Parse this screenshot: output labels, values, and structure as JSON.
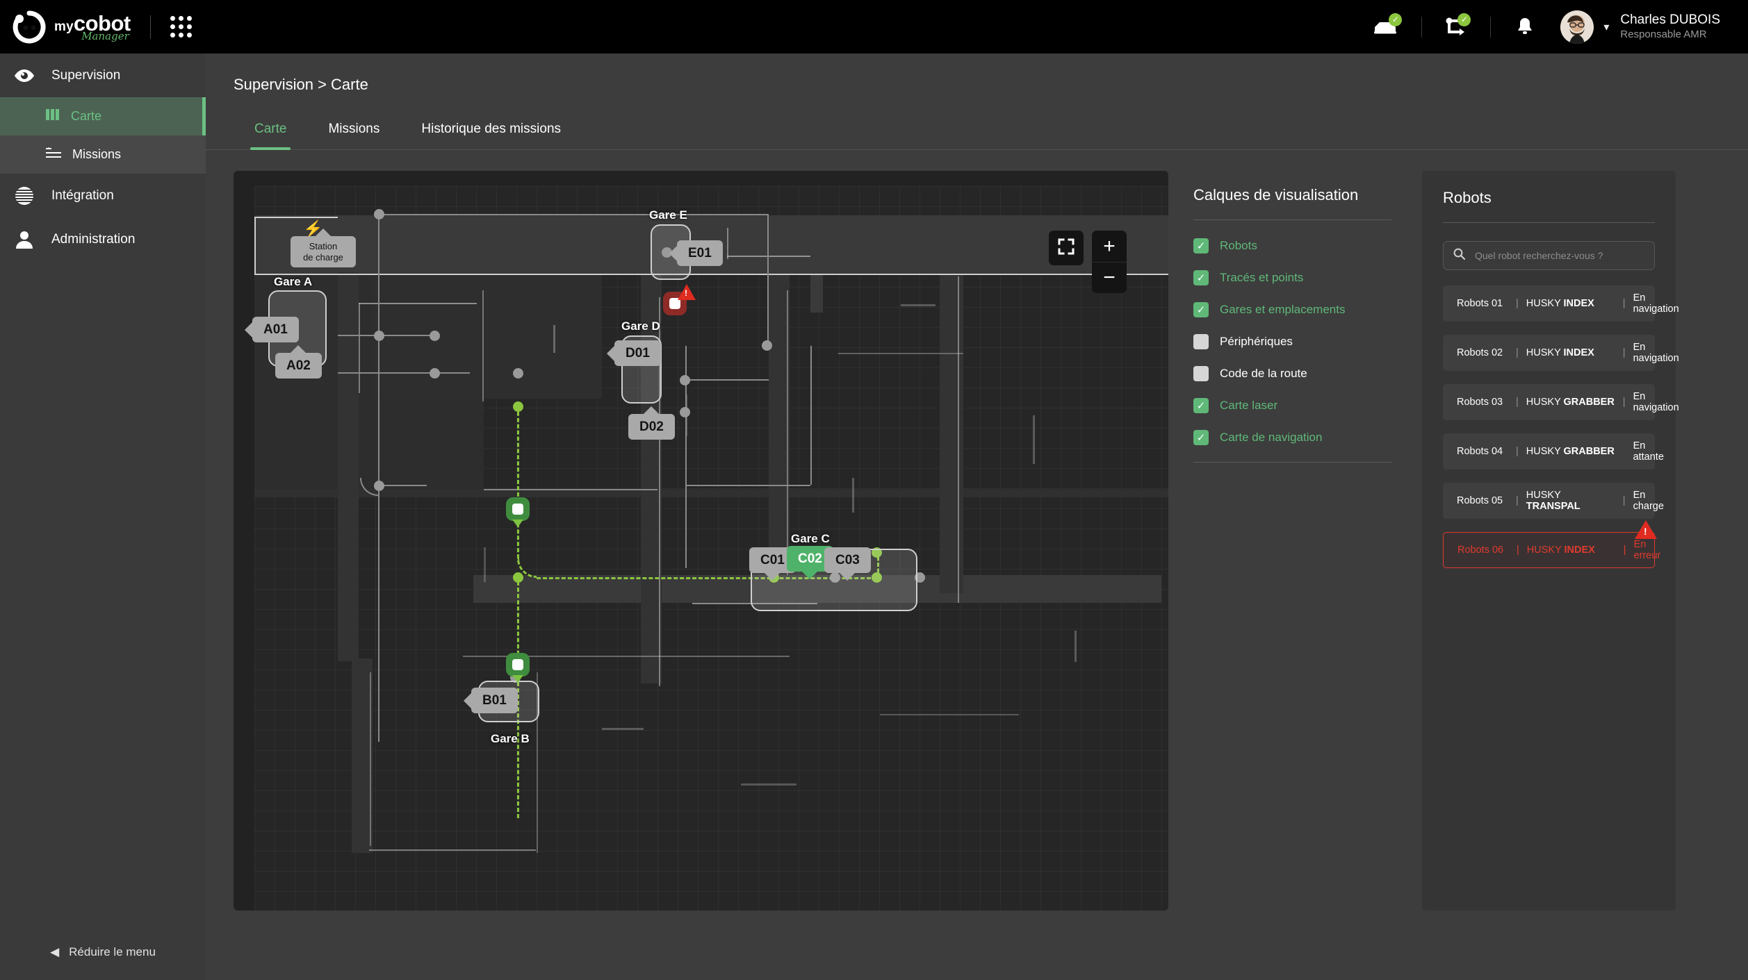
{
  "brand": {
    "my": "my",
    "cobot": "cobot",
    "manager": "Manager",
    "logo_icon": "cobot-logo-icon",
    "apps_icon": "apps-grid-icon"
  },
  "topbar": {
    "fleet_icon": "vehicle-status-icon",
    "fleet_badge": "✓",
    "flow_icon": "mission-flow-icon",
    "flow_badge": "✓",
    "bell_icon": "notifications-bell-icon",
    "chevron_icon": "chevron-down-icon",
    "user_name": "Charles DUBOIS",
    "user_role": "Responsable AMR"
  },
  "sidebar": {
    "items": [
      {
        "label": "Supervision",
        "icon": "eye-icon",
        "type": "section",
        "active": false
      },
      {
        "label": "Carte",
        "icon": "columns-icon",
        "type": "sub",
        "active": true
      },
      {
        "label": "Missions",
        "icon": "list-icon",
        "type": "sub",
        "active": false
      },
      {
        "label": "Intégration",
        "icon": "globe-icon",
        "type": "section",
        "active": false
      },
      {
        "label": "Administration",
        "icon": "user-icon",
        "type": "section",
        "active": false
      }
    ],
    "collapse_label": "Réduire le menu",
    "collapse_icon": "caret-left-icon"
  },
  "breadcrumb": "Supervision > Carte",
  "tabs": [
    {
      "label": "Carte",
      "active": true
    },
    {
      "label": "Missions",
      "active": false
    },
    {
      "label": "Historique des missions",
      "active": false
    }
  ],
  "map": {
    "controls": {
      "fullscreen_icon": "fullscreen-icon",
      "zoom_in_label": "+",
      "zoom_out_label": "−"
    },
    "charging_station": {
      "label": "Station\nde charge",
      "line1": "Station",
      "line2": "de charge",
      "icon": "lightning-bolt-icon"
    },
    "stations": [
      {
        "name": "Gare A",
        "slots": [
          "A01",
          "A02"
        ]
      },
      {
        "name": "Gare B",
        "slots": [
          "B01"
        ]
      },
      {
        "name": "Gare C",
        "slots": [
          "C01",
          "C02",
          "C03"
        ],
        "active_slot": "C02"
      },
      {
        "name": "Gare D",
        "slots": [
          "D01",
          "D02"
        ]
      },
      {
        "name": "Gare E",
        "slots": [
          "E01"
        ]
      }
    ],
    "robot_markers": [
      {
        "state": "ok"
      },
      {
        "state": "ok"
      },
      {
        "state": "error",
        "badge": "!"
      }
    ]
  },
  "layers": {
    "title": "Calques de visualisation",
    "items": [
      {
        "label": "Robots",
        "checked": true
      },
      {
        "label": "Tracés et points",
        "checked": true
      },
      {
        "label": "Gares et emplacements",
        "checked": true
      },
      {
        "label": "Périphériques",
        "checked": false
      },
      {
        "label": "Code de la route",
        "checked": false
      },
      {
        "label": "Carte laser",
        "checked": true
      },
      {
        "label": "Carte de navigation",
        "checked": true
      }
    ]
  },
  "robots_panel": {
    "title": "Robots",
    "search_placeholder": "Quel robot recherchez-vous ?",
    "search_value": "",
    "search_icon": "search-icon",
    "rows": [
      {
        "name": "Robots 01",
        "model_prefix": "HUSKY",
        "model": "INDEX",
        "status": "En navigation",
        "error": false
      },
      {
        "name": "Robots 02",
        "model_prefix": "HUSKY",
        "model": "INDEX",
        "status": "En navigation",
        "error": false
      },
      {
        "name": "Robots 03",
        "model_prefix": "HUSKY",
        "model": "GRABBER",
        "status": "En navigation",
        "error": false
      },
      {
        "name": "Robots 04",
        "model_prefix": "HUSKY",
        "model": "GRABBER",
        "status": "En attante",
        "error": false
      },
      {
        "name": "Robots 05",
        "model_prefix": "HUSKY",
        "model": "TRANSPAL",
        "status": "En charge",
        "error": false
      },
      {
        "name": "Robots 06",
        "model_prefix": "HUSKY",
        "model": "INDEX",
        "status": "En erreur",
        "error": true,
        "badge": "!"
      }
    ]
  },
  "colors": {
    "accent_green": "#6cc083",
    "path_green": "#8cc63f",
    "error_red": "#e03a2f",
    "topbar_bg": "#000000",
    "sidebar_bg": "#3a3a3a",
    "page_bg": "#3d3d3d",
    "map_bg": "#222222"
  }
}
